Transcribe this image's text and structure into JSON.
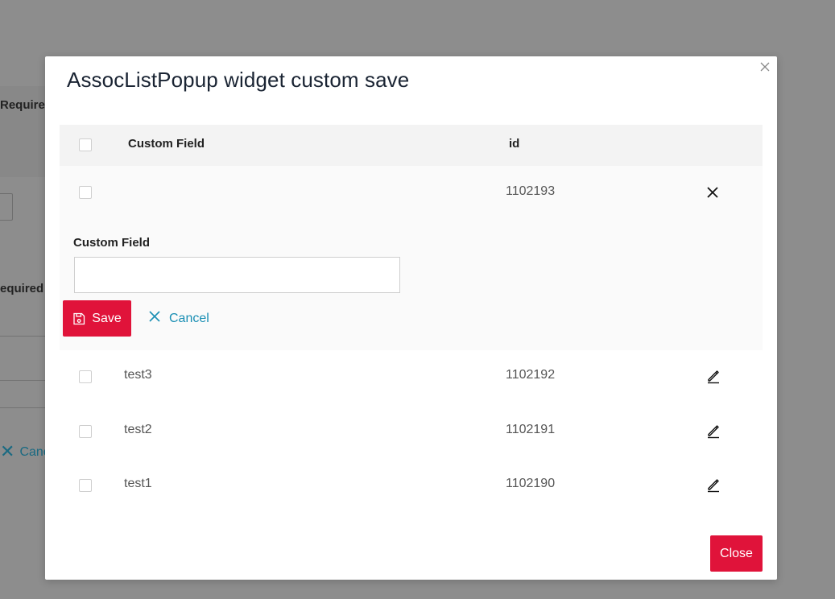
{
  "background": {
    "label_required_1": "Required",
    "label_required_2": "equired",
    "cancel_text": "Canc"
  },
  "modal": {
    "title": "AssocListPopup widget custom save",
    "columns": {
      "field": "Custom Field",
      "id": "id"
    },
    "editing_row": {
      "field": "",
      "id": "1102193"
    },
    "editor": {
      "label": "Custom Field",
      "value": "",
      "placeholder": "",
      "save_label": "Save",
      "cancel_label": "Cancel"
    },
    "rows": [
      {
        "field": "test3",
        "id": "1102192"
      },
      {
        "field": "test2",
        "id": "1102191"
      },
      {
        "field": "test1",
        "id": "1102190"
      }
    ],
    "close_label": "Close"
  },
  "colors": {
    "accent": "#e0133a",
    "link": "#1a8fb4",
    "title": "#1a2433"
  },
  "icons": {
    "close": "close-icon",
    "save": "save-icon",
    "cancel": "x-icon",
    "edit": "pencil-icon"
  }
}
